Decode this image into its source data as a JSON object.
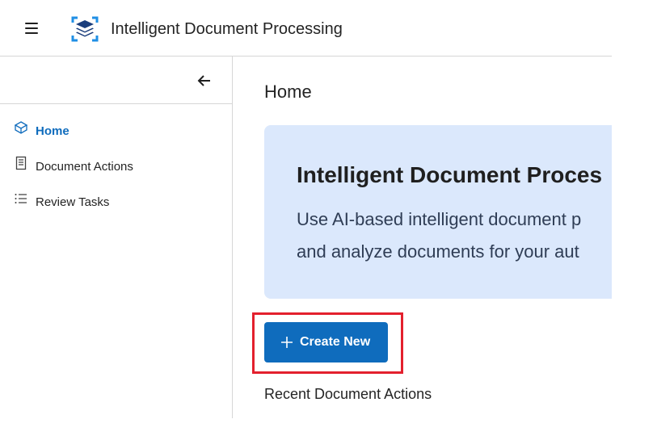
{
  "header": {
    "app_title": "Intelligent Document Processing",
    "menu_icon": "hamburger-menu-icon",
    "logo_icon": "stack-scan-logo-icon"
  },
  "sidebar": {
    "collapse_icon": "arrow-left-icon",
    "items": [
      {
        "label": "Home",
        "icon": "cube-icon",
        "active": true
      },
      {
        "label": "Document Actions",
        "icon": "document-icon",
        "active": false
      },
      {
        "label": "Review Tasks",
        "icon": "list-icon",
        "active": false
      }
    ]
  },
  "main": {
    "page_title": "Home",
    "hero": {
      "title": "Intelligent Document Proces",
      "line1": "Use AI-based intelligent document p",
      "line2": "and analyze documents for your aut"
    },
    "create_button": {
      "label": "Create New",
      "icon": "plus-icon"
    },
    "recent_heading": "Recent Document Actions"
  },
  "colors": {
    "accent": "#0f6cbd",
    "hero_bg": "#dbe8fc",
    "highlight": "#e3202d",
    "divider": "#d6d6d6"
  }
}
